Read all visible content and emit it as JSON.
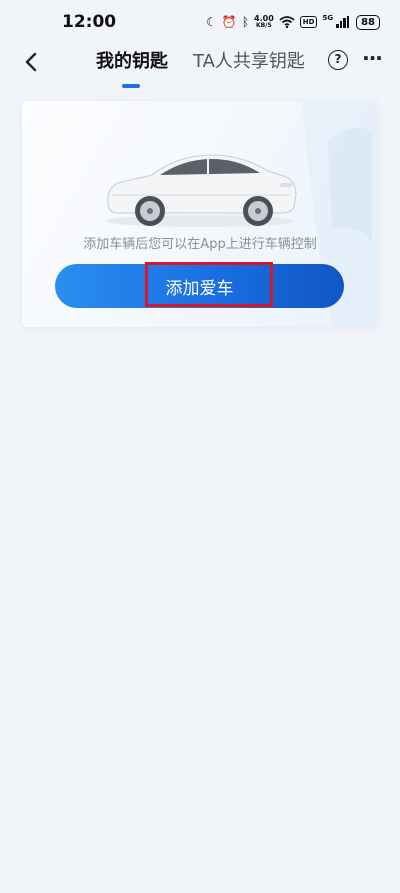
{
  "status_bar": {
    "time": "12:00",
    "net_speed_value": "4.00",
    "net_speed_unit": "KB/S",
    "hd_label": "HD",
    "network_label": "5G",
    "battery": "88"
  },
  "nav": {
    "tabs": [
      {
        "label": "我的钥匙",
        "active": true
      },
      {
        "label": "TA人共享钥匙",
        "active": false
      }
    ],
    "help_label": "?",
    "more_label": "···"
  },
  "card": {
    "hint": "添加车辆后您可以在App上进行车辆控制",
    "add_button_label": "添加爱车"
  },
  "colors": {
    "accent": "#1d6fe6",
    "highlight_border": "#d6182a",
    "page_background": "#f1f4f9"
  }
}
